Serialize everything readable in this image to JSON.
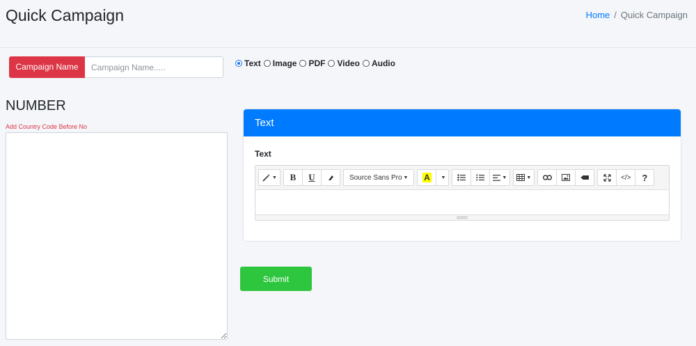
{
  "header": {
    "title": "Quick Campaign",
    "breadcrumb": {
      "home": "Home",
      "separator": "/",
      "current": "Quick Campaign"
    }
  },
  "campaign": {
    "label": "Campaign Name",
    "placeholder": "Campaign Name.....",
    "value": ""
  },
  "media_types": {
    "selected": "Text",
    "options": [
      "Text",
      "Image",
      "PDF",
      "Video",
      "Audio"
    ]
  },
  "number": {
    "title": "NUMBER",
    "hint": "Add Country Code Before No",
    "value": ""
  },
  "card": {
    "header": "Text",
    "field_label": "Text",
    "toolbar": {
      "font_name": "Source Sans Pro",
      "color_letter": "A",
      "bold": "B",
      "underline": "U",
      "help": "?",
      "code": "</>"
    }
  },
  "submit_label": "Submit",
  "colors": {
    "accent": "#007bff",
    "danger": "#dc3545",
    "success": "#2ec63f",
    "background": "#f4f6f9"
  }
}
